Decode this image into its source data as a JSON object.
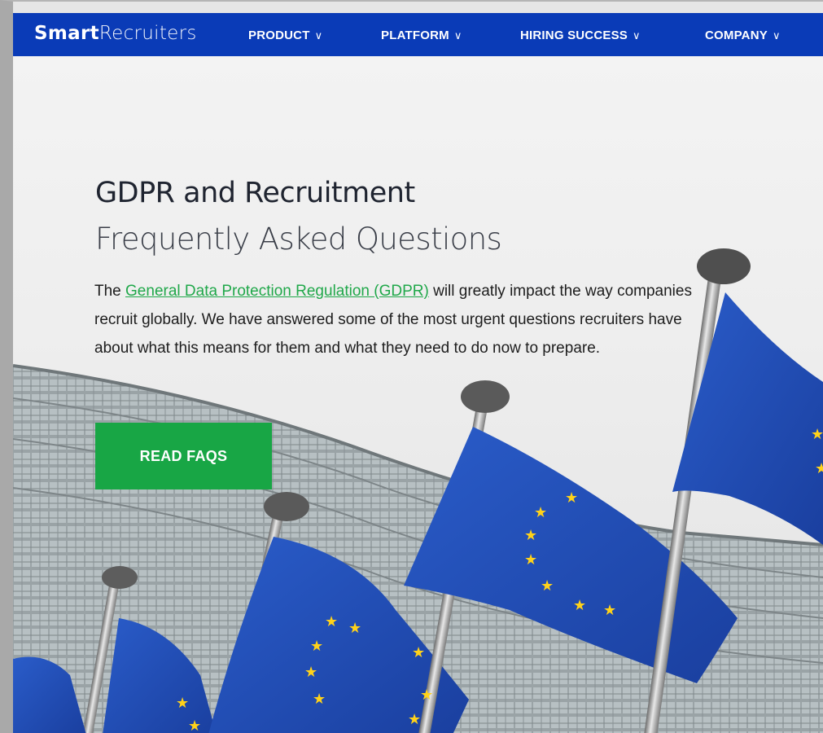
{
  "header": {
    "logo_bold": "Smart",
    "logo_light": "Recruiters",
    "nav": [
      {
        "label": "PRODUCT",
        "chevron": "∨"
      },
      {
        "label": "PLATFORM",
        "chevron": "∨"
      },
      {
        "label": "HIRING SUCCESS",
        "chevron": "∨"
      },
      {
        "label": "COMPANY",
        "chevron": "∨"
      }
    ]
  },
  "hero": {
    "title": "GDPR and Recruitment",
    "subtitle": "Frequently Asked Questions",
    "intro_before": "The ",
    "intro_link": "General Data Protection Regulation (GDPR)",
    "intro_after": " will greatly impact the way companies recruit globally. We have answered some of the most urgent questions recruiters have about what this means for them and what they need to do now to prepare.",
    "cta_label": "READ FAQS"
  },
  "colors": {
    "nav_bg": "#0a3bb7",
    "link": "#20a84a",
    "cta_bg": "#18a645",
    "flag_blue": "#1f4fb8",
    "star": "#ffd21a"
  }
}
